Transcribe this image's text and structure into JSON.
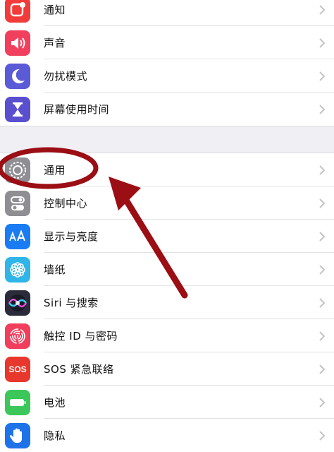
{
  "group1": [
    {
      "label": "通知",
      "icon": "notifications-icon",
      "color": "#f23b3b"
    },
    {
      "label": "声音",
      "icon": "speaker-icon",
      "color": "#f0405e"
    },
    {
      "label": "勿扰模式",
      "icon": "moon-icon",
      "color": "#5b5bd8"
    },
    {
      "label": "屏幕使用时间",
      "icon": "hourglass-icon",
      "color": "#5a4fcf"
    }
  ],
  "group2": [
    {
      "label": "通用",
      "icon": "gear-icon",
      "color": "#8e8e93"
    },
    {
      "label": "控制中心",
      "icon": "toggles-icon",
      "color": "#8e8e93"
    },
    {
      "label": "显示与亮度",
      "icon": "text-size-icon",
      "color": "#1a7cf2"
    },
    {
      "label": "墙纸",
      "icon": "flower-icon",
      "color": "#2fb5e8"
    },
    {
      "label": "Siri 与搜索",
      "icon": "siri-icon",
      "color": "#2b2b3a"
    },
    {
      "label": "触控 ID 与密码",
      "icon": "fingerprint-icon",
      "color": "#f03e5c"
    },
    {
      "label": "SOS 紧急联络",
      "icon": "sos-icon",
      "color": "#e8372c",
      "icon_text": "SOS"
    },
    {
      "label": "电池",
      "icon": "battery-icon",
      "color": "#3cc75a"
    },
    {
      "label": "隐私",
      "icon": "hand-icon",
      "color": "#1e73e8"
    }
  ],
  "annotation": {
    "color": "#9b0e14",
    "highlighted_item": "通用"
  }
}
